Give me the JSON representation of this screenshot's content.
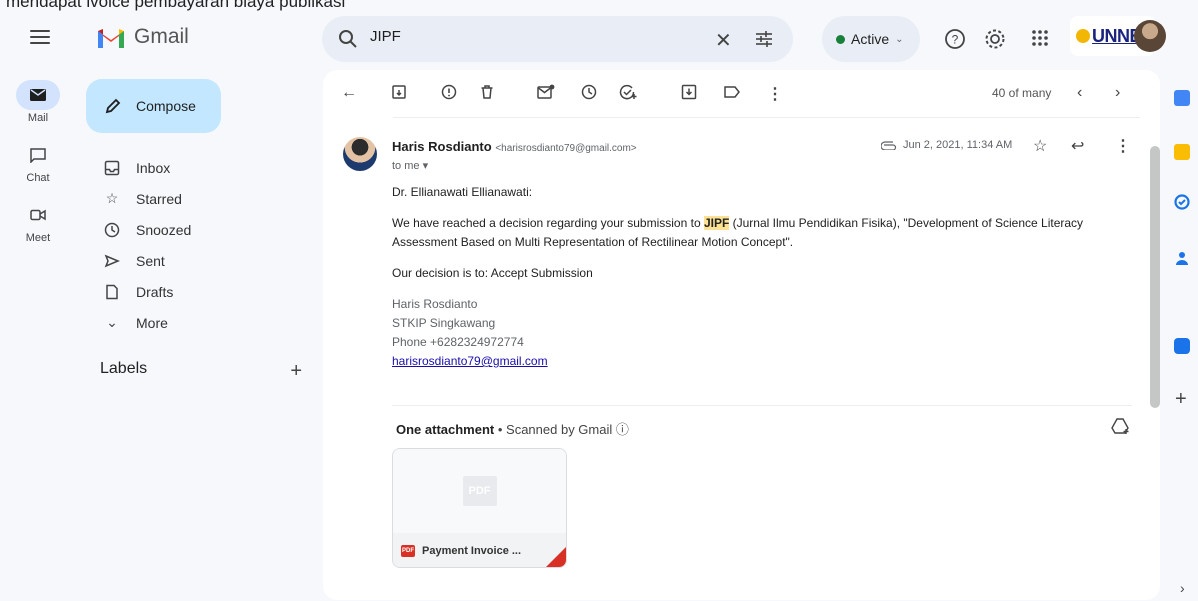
{
  "caption": "mendapat ivoice pembayaran biaya publikasi",
  "app": {
    "name": "Gmail"
  },
  "search": {
    "value": "JIPF"
  },
  "status": {
    "label": "Active"
  },
  "org": {
    "brand": "UNNES"
  },
  "rail": [
    {
      "label": "Mail",
      "icon": "mail-icon"
    },
    {
      "label": "Chat",
      "icon": "chat-icon"
    },
    {
      "label": "Meet",
      "icon": "meet-icon"
    }
  ],
  "compose_label": "Compose",
  "nav": [
    {
      "label": "Inbox",
      "icon": "inbox-icon"
    },
    {
      "label": "Starred",
      "icon": "star-icon"
    },
    {
      "label": "Snoozed",
      "icon": "clock-icon"
    },
    {
      "label": "Sent",
      "icon": "send-icon"
    },
    {
      "label": "Drafts",
      "icon": "draft-icon"
    },
    {
      "label": "More",
      "icon": "chevron-down-icon"
    }
  ],
  "labels_heading": "Labels",
  "pager": {
    "text": "40 of many"
  },
  "message": {
    "sender_name": "Haris Rosdianto",
    "sender_email": "<harisrosdianto79@gmail.com>",
    "to": "to me",
    "date": "Jun 2, 2021, 11:34 AM",
    "greeting": "Dr. Ellianawati Ellianawati:",
    "body_pre": "We have reached a decision regarding your submission to ",
    "highlight": "JIPF",
    "body_post": " (Jurnal Ilmu Pendidikan Fisika), \"Development of Science Literacy Assessment Based on Multi Representation of Rectilinear Motion Concept\".",
    "decision": "Our decision is to: Accept Submission",
    "sig_name": "Haris Rosdianto",
    "sig_org": "STKIP Singkawang",
    "sig_phone": "Phone +6282324972774",
    "sig_email": "harisrosdianto79@gmail.com"
  },
  "attachment": {
    "heading": "One attachment",
    "scanned": " • Scanned by Gmail ⓘ",
    "preview_label": "PDF",
    "badge": "PDF",
    "filename": "Payment Invoice ..."
  },
  "colors": {
    "accent": "#0b57d0",
    "compose_bg": "#c2e7ff",
    "highlight": "#fde293",
    "active_dot": "#188038"
  }
}
